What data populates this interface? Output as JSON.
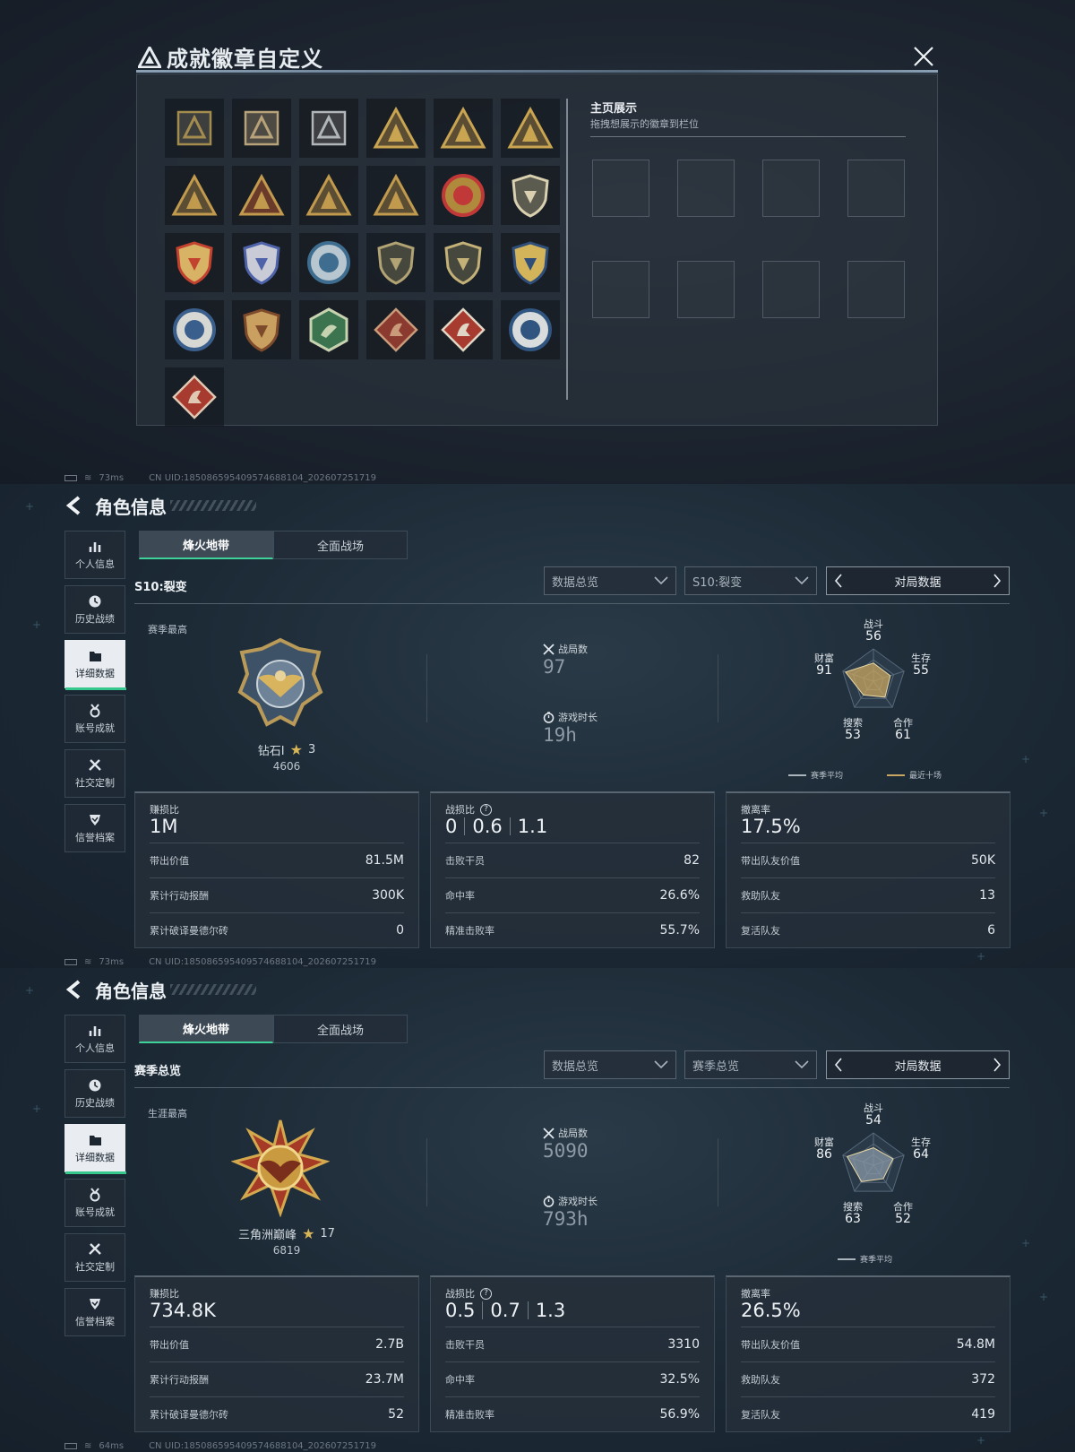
{
  "badge_dialog": {
    "title": "成就徽章自定义",
    "showcase_title": "主页展示",
    "showcase_hint": "拖拽想展示的徽章到栏位",
    "badges": [
      {
        "icon": "triangle-badge-icon",
        "shape": "square",
        "c": "#a48b4e",
        "bg": "#3c3f3e"
      },
      {
        "icon": "helicopter-badge-icon",
        "shape": "square",
        "c": "#b7a27a",
        "bg": "#4c4a42"
      },
      {
        "icon": "shield-badge-icon",
        "shape": "square",
        "c": "#b1b6b8",
        "bg": "#3d3f43"
      },
      {
        "icon": "triangle-55-badge-icon",
        "shape": "tri",
        "c": "#c9a451",
        "bg": "#5a4d33"
      },
      {
        "icon": "triangle-k-badge-icon",
        "shape": "tri",
        "c": "#c9a451",
        "bg": "#5a4d33"
      },
      {
        "icon": "triangle-58-badge-icon",
        "shape": "tri",
        "c": "#c9a451",
        "bg": "#5a4d33"
      },
      {
        "icon": "triangle-soldier-badge-icon",
        "shape": "tri",
        "c": "#c29a4d",
        "bg": "#5a4d33"
      },
      {
        "icon": "triangle-one-badge-icon",
        "shape": "tri",
        "c": "#c29a4d",
        "bg": "#6a3a2a"
      },
      {
        "icon": "triangle-hand-badge-icon",
        "shape": "tri",
        "c": "#c29a4d",
        "bg": "#5a4d33"
      },
      {
        "icon": "triangle-tower-badge-icon",
        "shape": "tri",
        "c": "#c29a4d",
        "bg": "#5a4d33"
      },
      {
        "icon": "star-medal-badge-icon",
        "shape": "circle",
        "c": "#c03838",
        "bg": "#b08a3c"
      },
      {
        "icon": "shield-emblem-badge-icon",
        "shape": "shield",
        "c": "#d9d0b0",
        "bg": "#5c5b50"
      },
      {
        "icon": "red-shield-badge-icon",
        "shape": "shield",
        "c": "#c2412f",
        "bg": "#d8b265"
      },
      {
        "icon": "blue-shield-badge-icon",
        "shape": "shield",
        "c": "#4d62a9",
        "bg": "#c9cbd6"
      },
      {
        "icon": "blue-gun-badge-icon",
        "shape": "circle",
        "c": "#3e6d90",
        "bg": "#b8c6cf"
      },
      {
        "icon": "rifle-badge-icon",
        "shape": "shield",
        "c": "#b1a373",
        "bg": "#47483d"
      },
      {
        "icon": "rifle-crossed-badge-icon",
        "shape": "shield",
        "c": "#c3b178",
        "bg": "#47483d"
      },
      {
        "icon": "winged-gun-badge-icon",
        "shape": "shield",
        "c": "#2f4f7a",
        "bg": "#d3b45b"
      },
      {
        "icon": "eagle-head-badge-icon",
        "shape": "circle",
        "c": "#3b5f8c",
        "bg": "#d7d8d4"
      },
      {
        "icon": "lion-badge-icon",
        "shape": "shield",
        "c": "#7d4a2c",
        "bg": "#c9a05f"
      },
      {
        "icon": "dragon-badge-icon",
        "shape": "hex",
        "c": "#3c7450",
        "bg": "#c7d3b0"
      },
      {
        "icon": "dragon-red-badge-icon",
        "shape": "diamond",
        "c": "#8a3a2e",
        "bg": "#c99b7a"
      },
      {
        "icon": "horse-red-badge-icon",
        "shape": "diamond",
        "c": "#a83b30",
        "bg": "#e0d6c5"
      },
      {
        "icon": "wolf-badge-icon",
        "shape": "circle",
        "c": "#2f5580",
        "bg": "#d8dcdc"
      },
      {
        "icon": "horse-diamond-badge-icon",
        "shape": "diamond",
        "c": "#a83b30",
        "bg": "#e0c9b3"
      }
    ]
  },
  "status_bars": [
    {
      "ping": "73ms",
      "uid": "CN UID:18508659540957468810­4_202607251719"
    },
    {
      "ping": "73ms",
      "uid": "CN UID:18508659540957468810­4_202607251719"
    },
    {
      "ping": "64ms",
      "uid": "CN UID:18508659540957468810­4_202607251719"
    }
  ],
  "profiles": [
    {
      "page_title": "角色信息",
      "nav": [
        {
          "label": "个人信息",
          "icon": "bar-chart-icon"
        },
        {
          "label": "历史战绩",
          "icon": "clock-icon"
        },
        {
          "label": "详细数据",
          "icon": "folder-icon",
          "active": true
        },
        {
          "label": "账号成就",
          "icon": "medal-icon"
        },
        {
          "label": "社交定制",
          "icon": "tools-icon"
        },
        {
          "label": "信誉档案",
          "icon": "shield-check-icon"
        }
      ],
      "tabs": [
        "烽火地带",
        "全面战场"
      ],
      "section": "S10:裂变",
      "dropdown1": "数据总览",
      "dropdown2": "S10:裂变",
      "pager_label": "对局数据",
      "best_label": "赛季最高",
      "emblem": "eagle-emblem-icon",
      "rank_name": "钻石I",
      "rank_stars": "3",
      "rank_score": "4606",
      "matches_label": "战局数",
      "matches": "97",
      "time_label": "游戏时长",
      "time": "19h",
      "radar": {
        "combat": {
          "label": "战斗",
          "value": 56
        },
        "survival": {
          "label": "生存",
          "value": 55
        },
        "coop": {
          "label": "合作",
          "value": 61
        },
        "search": {
          "label": "搜索",
          "value": 53
        },
        "wealth": {
          "label": "财富",
          "value": 91
        }
      },
      "legend": [
        "赛季平均",
        "最近十场"
      ],
      "card1": {
        "cap": "赚损比",
        "big": "1M",
        "rows": [
          {
            "k": "带出价值",
            "v": "81.5M"
          },
          {
            "k": "累计行动报酬",
            "v": "300K"
          },
          {
            "k": "累计破译曼德尔砖",
            "v": "0"
          }
        ]
      },
      "card2": {
        "cap": "战损比",
        "kd": [
          "0",
          "0.6",
          "1.1"
        ],
        "rows": [
          {
            "k": "击败干员",
            "v": "82"
          },
          {
            "k": "命中率",
            "v": "26.6%"
          },
          {
            "k": "精准击败率",
            "v": "55.7%"
          }
        ]
      },
      "card3": {
        "cap": "撤离率",
        "big": "17.5%",
        "rows": [
          {
            "k": "带出队友价值",
            "v": "50K"
          },
          {
            "k": "救助队友",
            "v": "13"
          },
          {
            "k": "复活队友",
            "v": "6"
          }
        ]
      }
    },
    {
      "page_title": "角色信息",
      "nav": [
        {
          "label": "个人信息",
          "icon": "bar-chart-icon"
        },
        {
          "label": "历史战绩",
          "icon": "clock-icon"
        },
        {
          "label": "详细数据",
          "icon": "folder-icon",
          "active": true
        },
        {
          "label": "账号成就",
          "icon": "medal-icon"
        },
        {
          "label": "社交定制",
          "icon": "tools-icon"
        },
        {
          "label": "信誉档案",
          "icon": "shield-check-icon"
        }
      ],
      "tabs": [
        "烽火地带",
        "全面战场"
      ],
      "section": "赛季总览",
      "dropdown1": "数据总览",
      "dropdown2": "赛季总览",
      "pager_label": "对局数据",
      "best_label": "生涯最高",
      "emblem": "winged-star-emblem-icon",
      "rank_name": "三角洲巅峰",
      "rank_stars": "17",
      "rank_score": "6819",
      "matches_label": "战局数",
      "matches": "5090",
      "time_label": "游戏时长",
      "time": "793h",
      "radar": {
        "combat": {
          "label": "战斗",
          "value": 54
        },
        "survival": {
          "label": "生存",
          "value": 64
        },
        "coop": {
          "label": "合作",
          "value": 52
        },
        "search": {
          "label": "搜索",
          "value": 63
        },
        "wealth": {
          "label": "财富",
          "value": 86
        }
      },
      "legend": [
        "赛季平均"
      ],
      "card1": {
        "cap": "赚损比",
        "big": "734.8K",
        "rows": [
          {
            "k": "带出价值",
            "v": "2.7B"
          },
          {
            "k": "累计行动报酬",
            "v": "23.7M"
          },
          {
            "k": "累计破译曼德尔砖",
            "v": "52"
          }
        ]
      },
      "card2": {
        "cap": "战损比",
        "kd": [
          "0.5",
          "0.7",
          "1.3"
        ],
        "rows": [
          {
            "k": "击败干员",
            "v": "3310"
          },
          {
            "k": "命中率",
            "v": "32.5%"
          },
          {
            "k": "精准击败率",
            "v": "56.9%"
          }
        ]
      },
      "card3": {
        "cap": "撤离率",
        "big": "26.5%",
        "rows": [
          {
            "k": "带出队友价值",
            "v": "54.8M"
          },
          {
            "k": "救助队友",
            "v": "372"
          },
          {
            "k": "复活队友",
            "v": "419"
          }
        ]
      }
    }
  ],
  "colors": {
    "accent_green": "#35c78c",
    "gold": "#c9a451",
    "radar_fill_season": "#c9a762",
    "radar_fill_recent": "#8a98a6"
  }
}
